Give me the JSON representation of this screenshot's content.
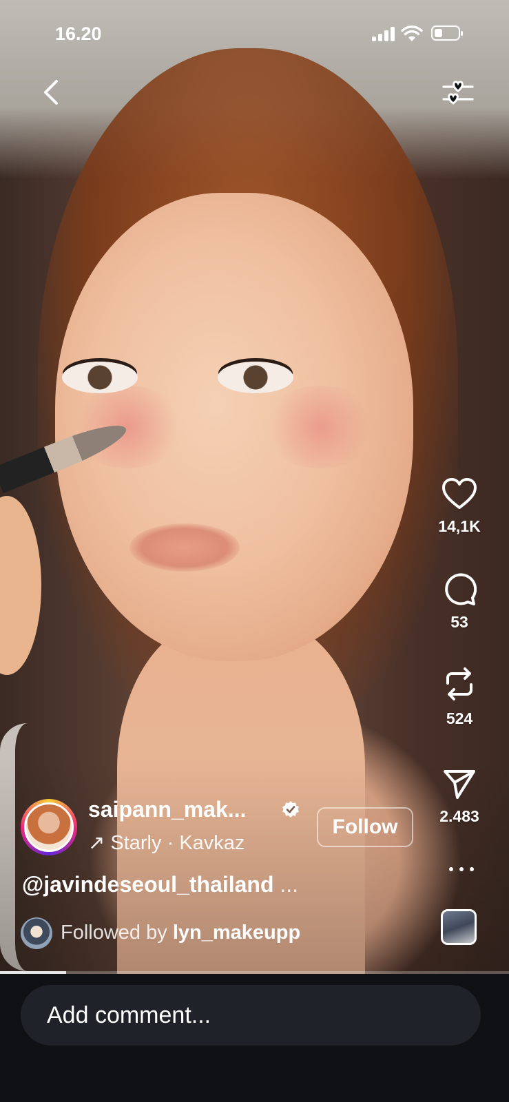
{
  "status_bar": {
    "time": "16.20",
    "battery_level": 0.35
  },
  "post": {
    "username": "saipann_mak...",
    "verified": true,
    "audio": {
      "arrow": "↗",
      "artist": "Starly",
      "separator": "·",
      "track": "Kavkaz"
    },
    "follow_label": "Follow",
    "caption": "@javindeseoul_thailand",
    "caption_more": "...",
    "followed_by_prefix": "Followed by",
    "followed_by_user": "lyn_makeupp"
  },
  "actions": {
    "likes": "14,1K",
    "comments": "53",
    "reposts": "524",
    "shares": "2.483"
  },
  "playback": {
    "progress": 0.13
  },
  "comment_box": {
    "placeholder": "Add comment..."
  },
  "icons": {
    "back": "chevron-left-icon",
    "filter": "sliders-heart-icon",
    "like": "heart-icon",
    "comment": "speech-bubble-icon",
    "repost": "repost-icon",
    "share": "paper-plane-icon",
    "more": "more-dots-icon"
  }
}
